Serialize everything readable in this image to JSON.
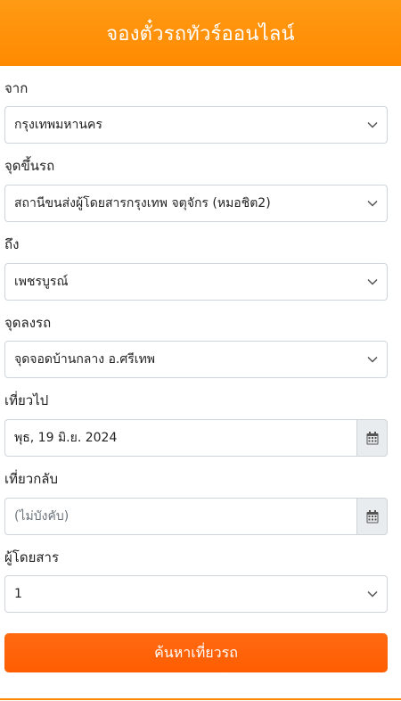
{
  "header": {
    "title": "จองตั๋วรถทัวร์ออนไลน์"
  },
  "form": {
    "from": {
      "label": "จาก",
      "value": "กรุงเทพมหานคร"
    },
    "pickup": {
      "label": "จุดขึ้นรถ",
      "value": "สถานีขนส่งผู้โดยสารกรุงเทพ จตุจักร (หมอชิต2)"
    },
    "to": {
      "label": "ถึง",
      "value": "เพชรบูรณ์"
    },
    "dropoff": {
      "label": "จุดลงรถ",
      "value": "จุดจอดบ้านกลาง อ.ศรีเทพ"
    },
    "depart": {
      "label": "เที่ยวไป",
      "value": "พุธ, 19 มิ.ย. 2024"
    },
    "return": {
      "label": "เที่ยวกลับ",
      "placeholder": "(ไม่บังคับ)"
    },
    "passengers": {
      "label": "ผู้โดยสาร",
      "value": "1"
    },
    "search_label": "ค้นหาเที่ยวรถ"
  },
  "icons": {
    "dropdown": "chevron-down-icon",
    "calendar": "calendar-icon"
  },
  "colors": {
    "header": "#ff8a00",
    "button": "#ff6200",
    "addon_bg": "#e9ecef",
    "border": "#cfd4da"
  }
}
